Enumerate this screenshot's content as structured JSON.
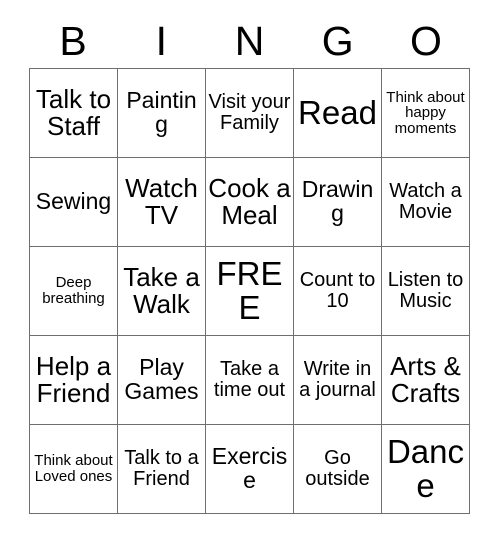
{
  "card": {
    "title_letters": [
      "B",
      "I",
      "N",
      "G",
      "O"
    ],
    "free_space_label": "FREE",
    "colors": {
      "background": "#ffffff",
      "text": "#000000",
      "grid_line": "#6f6f6f"
    },
    "columns": 5,
    "rows": 5,
    "cells": [
      {
        "text": "Talk to Staff",
        "size": "fs-lg"
      },
      {
        "text": "Painting",
        "size": "fs-md"
      },
      {
        "text": "Visit your Family",
        "size": "fs-sm"
      },
      {
        "text": "Read",
        "size": "fs-xl"
      },
      {
        "text": "Think about happy moments",
        "size": "fs-xs"
      },
      {
        "text": "Sewing",
        "size": "fs-md"
      },
      {
        "text": "Watch TV",
        "size": "fs-lg"
      },
      {
        "text": "Cook a Meal",
        "size": "fs-lg"
      },
      {
        "text": "Drawing",
        "size": "fs-md"
      },
      {
        "text": "Watch a Movie",
        "size": "fs-sm"
      },
      {
        "text": "Deep breathing",
        "size": "fs-xs"
      },
      {
        "text": "Take a Walk",
        "size": "fs-lg"
      },
      {
        "text": "FREE",
        "size": "fs-xl"
      },
      {
        "text": "Count to 10",
        "size": "fs-sm"
      },
      {
        "text": "Listen to Music",
        "size": "fs-sm"
      },
      {
        "text": "Help a Friend",
        "size": "fs-lg"
      },
      {
        "text": "Play Games",
        "size": "fs-md"
      },
      {
        "text": "Take a time out",
        "size": "fs-sm"
      },
      {
        "text": "Write in a journal",
        "size": "fs-sm"
      },
      {
        "text": "Arts & Crafts",
        "size": "fs-lg"
      },
      {
        "text": "Think about Loved ones",
        "size": "fs-xs"
      },
      {
        "text": "Talk to a Friend",
        "size": "fs-sm"
      },
      {
        "text": "Exercise",
        "size": "fs-md"
      },
      {
        "text": "Go outside",
        "size": "fs-sm"
      },
      {
        "text": "Dance",
        "size": "fs-xl"
      }
    ]
  }
}
